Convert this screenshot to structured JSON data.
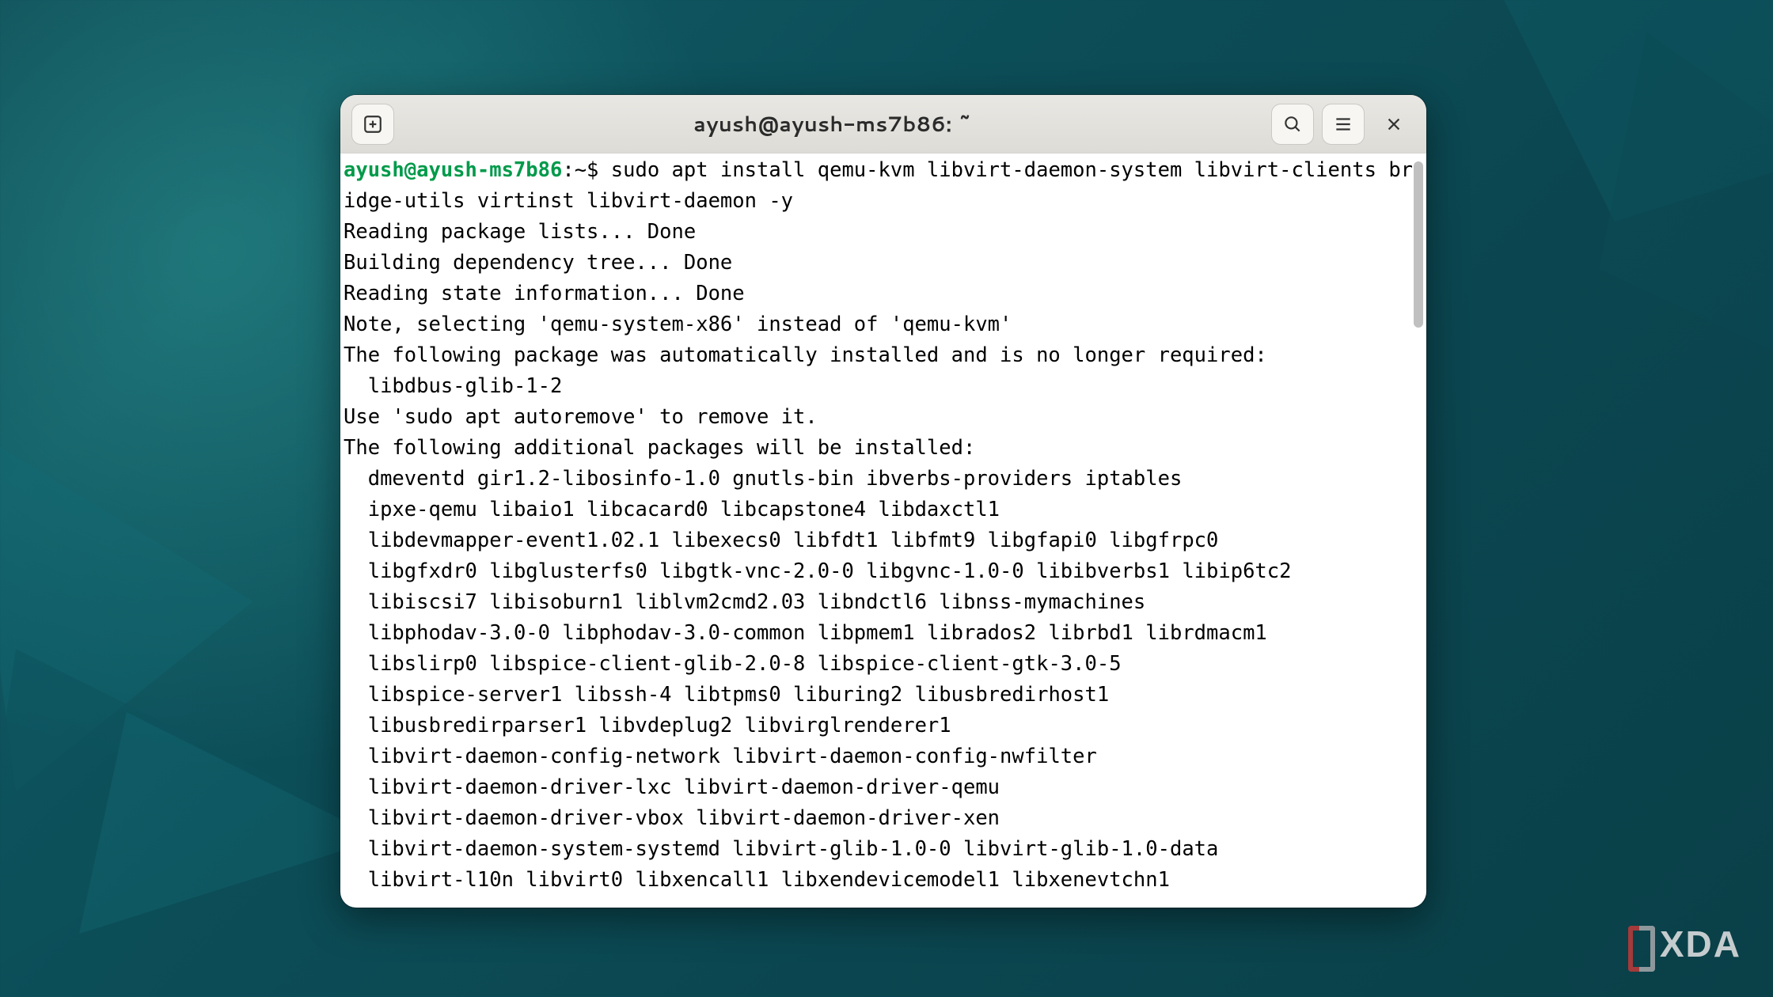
{
  "window": {
    "title": "ayush@ayush-ms7b86: ~"
  },
  "titlebar_icons": {
    "new_tab": "plus-box-icon",
    "search": "search-icon",
    "menu": "hamburger-icon",
    "close": "close-icon"
  },
  "terminal": {
    "prompt_user": "ayush@ayush-ms7b86",
    "prompt_suffix": ":~$ ",
    "command": "sudo apt install qemu-kvm libvirt-daemon-system libvirt-clients bridge-utils virtinst libvirt-daemon -y",
    "output": "Reading package lists... Done\nBuilding dependency tree... Done\nReading state information... Done\nNote, selecting 'qemu-system-x86' instead of 'qemu-kvm'\nThe following package was automatically installed and is no longer required:\n  libdbus-glib-1-2\nUse 'sudo apt autoremove' to remove it.\nThe following additional packages will be installed:\n  dmeventd gir1.2-libosinfo-1.0 gnutls-bin ibverbs-providers iptables\n  ipxe-qemu libaio1 libcacard0 libcapstone4 libdaxctl1\n  libdevmapper-event1.02.1 libexecs0 libfdt1 libfmt9 libgfapi0 libgfrpc0\n  libgfxdr0 libglusterfs0 libgtk-vnc-2.0-0 libgvnc-1.0-0 libibverbs1 libip6tc2\n  libiscsi7 libisoburn1 liblvm2cmd2.03 libndctl6 libnss-mymachines\n  libphodav-3.0-0 libphodav-3.0-common libpmem1 librados2 librbd1 librdmacm1\n  libslirp0 libspice-client-glib-2.0-8 libspice-client-gtk-3.0-5\n  libspice-server1 libssh-4 libtpms0 liburing2 libusbredirhost1\n  libusbredirparser1 libvdeplug2 libvirglrenderer1\n  libvirt-daemon-config-network libvirt-daemon-config-nwfilter\n  libvirt-daemon-driver-lxc libvirt-daemon-driver-qemu\n  libvirt-daemon-driver-vbox libvirt-daemon-driver-xen\n  libvirt-daemon-system-systemd libvirt-glib-1.0-0 libvirt-glib-1.0-data\n  libvirt-l10n libvirt0 libxencall1 libxendevicemodel1 libxenevtchn1"
  },
  "watermark": {
    "text": "XDA"
  }
}
